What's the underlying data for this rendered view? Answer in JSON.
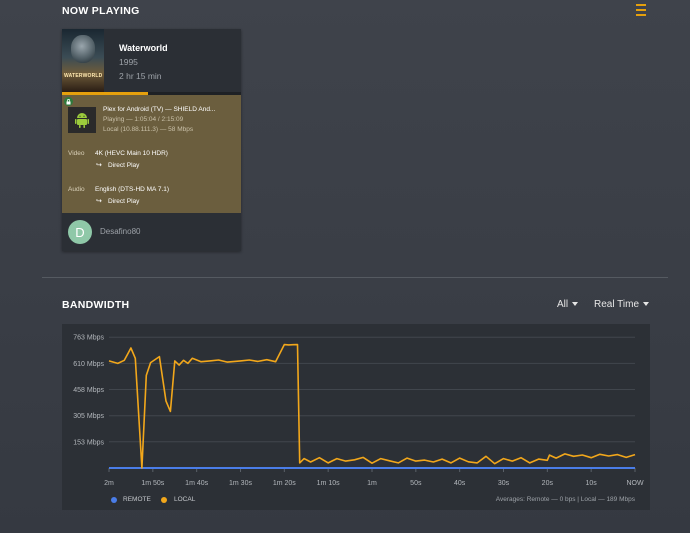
{
  "now_playing": {
    "title": "NOW PLAYING",
    "menu_icon": "list-icon",
    "accent_color": "#e5a00d"
  },
  "session": {
    "poster_title": "WATERWORLD",
    "title": "Waterworld",
    "year": "1995",
    "duration": "2 hr 15 min",
    "progress_fraction": 0.48,
    "player": "Plex for Android (TV)  —  SHIELD And...",
    "state": "Playing — 1:05:04 / 2:15:09",
    "location": "Local (10.88.111.3) — 58 Mbps",
    "video_label": "Video",
    "video_value": "4K (HEVC Main 10 HDR)",
    "video_decision": "Direct Play",
    "audio_label": "Audio",
    "audio_value": "English (DTS-HD MA 7.1)",
    "audio_decision": "Direct Play",
    "user_initial": "D",
    "username": "Desafino80",
    "avatar_color": "#8fc8a8",
    "panel_color": "#6b5e3e"
  },
  "bandwidth": {
    "title": "BANDWIDTH",
    "filter": "All",
    "range": "Real Time"
  },
  "chart_data": {
    "type": "line",
    "y_tick_labels": [
      "763 Mbps",
      "610 Mbps",
      "458 Mbps",
      "305 Mbps",
      "153 Mbps"
    ],
    "y_ticks": [
      763,
      610,
      458,
      305,
      153
    ],
    "ylim": [
      0,
      840
    ],
    "x_tick_labels": [
      "2m",
      "1m 50s",
      "1m 40s",
      "1m 30s",
      "1m 20s",
      "1m 10s",
      "1m",
      "50s",
      "40s",
      "30s",
      "20s",
      "10s",
      "NOW"
    ],
    "xlim": [
      -120,
      0
    ],
    "grid": true,
    "series": [
      {
        "name": "REMOTE",
        "color": "#4a7de8",
        "x": [
          -120,
          0
        ],
        "y": [
          0,
          0
        ]
      },
      {
        "name": "LOCAL",
        "color": "#f2a71b",
        "x": [
          -120,
          -118,
          -116.5,
          -115,
          -114,
          -112.5,
          -111.5,
          -110.5,
          -108.5,
          -107,
          -106,
          -105,
          -104,
          -103,
          -102,
          -101,
          -99,
          -97,
          -95,
          -93,
          -90,
          -88,
          -86,
          -84,
          -82,
          -80,
          -79,
          -78,
          -77,
          -76.5,
          -75.5,
          -74,
          -72,
          -70,
          -68,
          -66,
          -64,
          -62,
          -60,
          -58,
          -56,
          -54,
          -52,
          -50,
          -48,
          -46,
          -44,
          -42,
          -40,
          -38,
          -36,
          -34,
          -32,
          -30,
          -28,
          -26,
          -24,
          -22,
          -20,
          -19.5,
          -18,
          -16,
          -14,
          -12,
          -10,
          -8,
          -6,
          -4,
          -2,
          0
        ],
        "y": [
          625,
          610,
          628,
          700,
          640,
          0,
          540,
          615,
          650,
          390,
          330,
          625,
          600,
          628,
          610,
          640,
          620,
          625,
          630,
          618,
          625,
          630,
          622,
          632,
          620,
          720,
          718,
          719,
          720,
          30,
          55,
          35,
          60,
          30,
          55,
          40,
          48,
          62,
          28,
          55,
          42,
          30,
          58,
          40,
          46,
          35,
          52,
          30,
          58,
          36,
          30,
          68,
          25,
          55,
          40,
          60,
          30,
          52,
          45,
          75,
          58,
          82,
          68,
          76,
          60,
          80,
          70,
          78,
          62,
          78
        ]
      }
    ],
    "legend": [
      "REMOTE",
      "LOCAL"
    ],
    "legend_position": "bottom-left",
    "averages": "Averages: Remote — 0 bps | Local — 189 Mbps"
  }
}
